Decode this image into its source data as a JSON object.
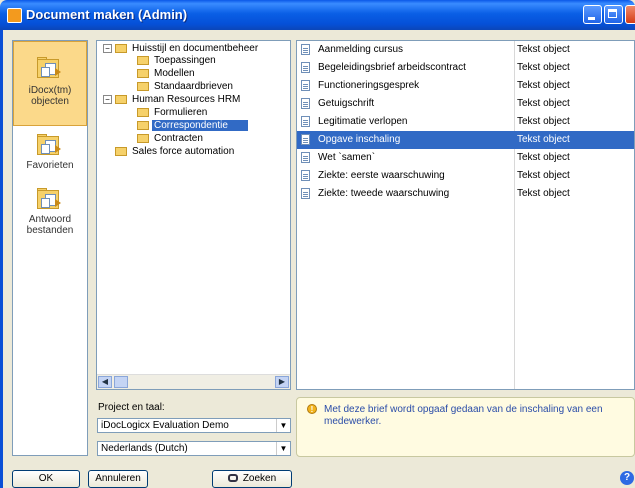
{
  "window": {
    "title": "Document maken (Admin)"
  },
  "sidebar": {
    "items": [
      {
        "label": "iDocx(tm) objecten",
        "icon": "folder-docs-icon",
        "active": true
      },
      {
        "label": "Favorieten",
        "icon": "folder-docs-icon",
        "active": false
      },
      {
        "label": "Antwoord bestanden",
        "icon": "folder-docs-icon",
        "active": false
      }
    ]
  },
  "tree": {
    "nodes": [
      {
        "label": "Huisstijl en documentbeheer",
        "expander": "−",
        "level": 0
      },
      {
        "label": "Toepassingen",
        "level": 1
      },
      {
        "label": "Modellen",
        "level": 1
      },
      {
        "label": "Standaardbrieven",
        "level": 1
      },
      {
        "label": "Human Resources HRM",
        "expander": "−",
        "level": 0
      },
      {
        "label": "Formulieren",
        "level": 1
      },
      {
        "label": "Correspondentie",
        "level": 1,
        "selected": true
      },
      {
        "label": "Contracten",
        "level": 1
      },
      {
        "label": "Sales force automation",
        "level": 0
      }
    ]
  },
  "list": {
    "rows": [
      {
        "name": "Aanmelding cursus",
        "type": "Tekst object"
      },
      {
        "name": "Begeleidingsbrief arbeidscontract",
        "type": "Tekst object"
      },
      {
        "name": "Functioneringsgesprek",
        "type": "Tekst object"
      },
      {
        "name": "Getuigschrift",
        "type": "Tekst object"
      },
      {
        "name": "Legitimatie verlopen",
        "type": "Tekst object"
      },
      {
        "name": "Opgave inschaling",
        "type": "Tekst object",
        "selected": true
      },
      {
        "name": "Wet `samen`",
        "type": "Tekst object"
      },
      {
        "name": "Ziekte: eerste waarschuwing",
        "type": "Tekst object"
      },
      {
        "name": "Ziekte: tweede waarschuwing",
        "type": "Tekst object"
      }
    ]
  },
  "project": {
    "label": "Project en taal:",
    "project_value": "iDocLogicx Evaluation Demo",
    "language_value": "Nederlands (Dutch)"
  },
  "info": {
    "text": "Met deze brief wordt opgaaf gedaan van de inschaling van een medewerker."
  },
  "buttons": {
    "ok": "OK",
    "cancel": "Annuleren",
    "search": "Zoeken"
  }
}
